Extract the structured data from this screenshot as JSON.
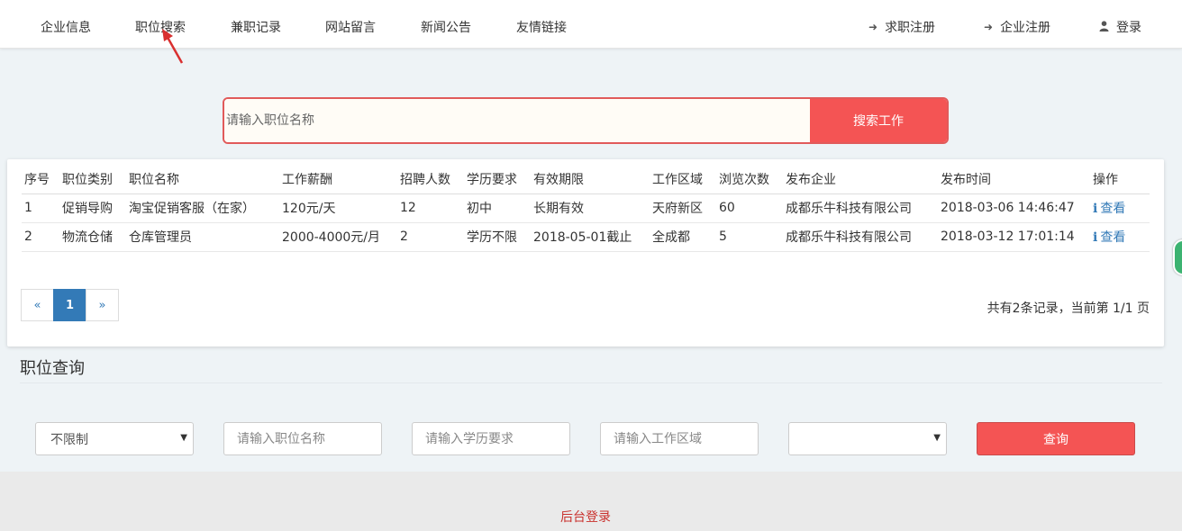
{
  "nav": {
    "left": [
      "企业信息",
      "职位搜索",
      "兼职记录",
      "网站留言",
      "新闻公告",
      "友情链接"
    ],
    "right": {
      "job_register": "求职注册",
      "company_register": "企业注册",
      "login": "登录"
    },
    "icons": {
      "register": "sign-in-icon",
      "login": "user-icon"
    }
  },
  "search": {
    "placeholder": "请输入职位名称",
    "button": "搜索工作"
  },
  "table": {
    "headers": [
      "序号",
      "职位类别",
      "职位名称",
      "工作薪酬",
      "招聘人数",
      "学历要求",
      "有效期限",
      "工作区域",
      "浏览次数",
      "发布企业",
      "发布时间",
      "操作"
    ],
    "rows": [
      [
        "1",
        "促销导购",
        "淘宝促销客服（在家）",
        "120元/天",
        "12",
        "初中",
        "长期有效",
        "天府新区",
        "60",
        "成都乐牛科技有限公司",
        "2018-03-06 14:46:47",
        "查看"
      ],
      [
        "2",
        "物流仓储",
        "仓库管理员",
        "2000-4000元/月",
        "2",
        "学历不限",
        "2018-05-01截止",
        "全成都",
        "5",
        "成都乐牛科技有限公司",
        "2018-03-12 17:01:14",
        "查看"
      ]
    ]
  },
  "pagination": {
    "prev": "«",
    "current": "1",
    "next": "»",
    "info": "共有2条记录，当前第 1/1 页"
  },
  "query": {
    "title": "职位查询",
    "category_value": "不限制",
    "name_placeholder": "请输入职位名称",
    "edu_placeholder": "请输入学历要求",
    "area_placeholder": "请输入工作区域",
    "extra_value": "",
    "button": "查询"
  },
  "footer": {
    "admin_login": "后台登录"
  },
  "colors": {
    "accent": "#f45454",
    "link": "#337ab7",
    "footer_link": "#c9302c"
  }
}
